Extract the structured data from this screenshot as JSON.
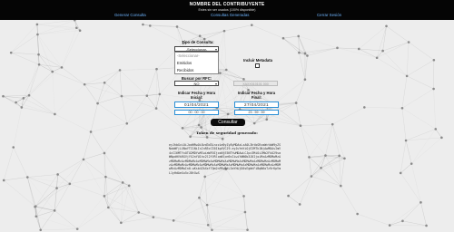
{
  "header": {
    "title": "NOMBRE DEL CONTRIBUYENTE",
    "subtitle": "Estes sin ser usados (100% disponible)",
    "nav": [
      "Generar Consulta",
      "Consultas Generadas",
      "Cerrar Sesión"
    ]
  },
  "form": {
    "tipo_label": "Tipo de Consulta:",
    "tipo_selected": "-Seleccionar-",
    "tipo_options": [
      "-Seleccionar-",
      "Emitidos",
      "Recibidos"
    ],
    "incluir_label": "Incluir Metadata",
    "rfc_label": "Buscar por RFC:",
    "rfc_selected": "NO",
    "rfc_placeholder": "XAXX010101 000",
    "fecha_inicial_label": "Indicar Fecha y Hora Inicial:",
    "fecha_final_label": "Indicar Fecha y Hora Final:",
    "fecha_inicial": "01/04/2021",
    "fecha_final": "27/04/2021",
    "hora_inicial": "00 : 00 : 00",
    "hora_final": "23 : 59 : 59",
    "consultar_button": "Consultar"
  },
  "token": {
    "label": "Token de seguridad generado:",
    "value": "eyJhbGciOiJodHRwOi8vd3d3LnczLm9yZy8yMDAxLzA0L3htbGRzaWctbW9yZSNobWFjLXNoYTI1NiIsInR5cCI6IkpXVCJ9.eyJuYmYiOjE2MTk1NjAwMDAsImV4cCI6MTYxOTU2MDYwMCwiaWF0IjoxNjE5NTYwMDAwLCJpc3MiOiJMb2FkU29saWNpdHVkRGVjYXJnYU1hc2l2YVRlcmNlcm9zIiwiYWN0b3J0IjoiMzAzMDMwMzAzMDMwMzAzMDMwMzAzMDMwMzAzMDMwMzAzMDMwMzAzMDMwMzAzMDMwMzAzMDMwMzAzMDMwMzAzMDMwMzAzMDMwMzAzMDMwMzAzMDMwMzAzMDMwMzAzMDMwMzAzMDMwMzAzMDMwIn0.wKsb4ZkXxf7Qm2nP8vRtL3aYhUjD0sEgWcFiBqN6oTz9rKpVmL1yHdAeXu5cJ8tGwS"
  },
  "colors": {
    "topbar": "#050505",
    "nav_link": "#6fb5ff",
    "input_border": "#2a8fd6",
    "button": "#0b0b0b"
  }
}
